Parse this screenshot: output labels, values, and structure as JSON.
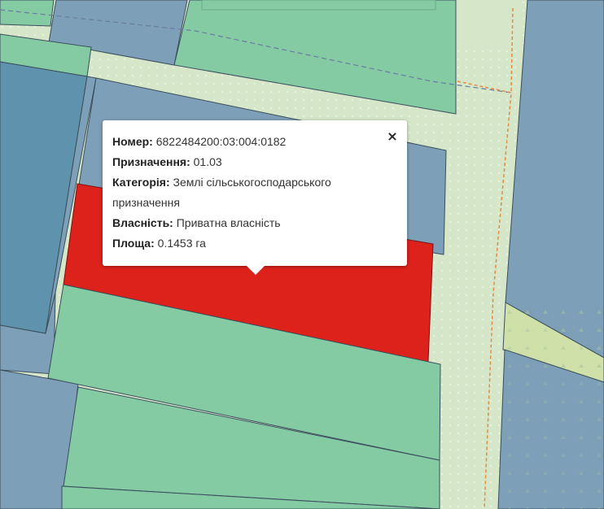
{
  "colors": {
    "background": "#d5e6c9",
    "parcel_blue": "#7d9fb7",
    "parcel_deep_blue": "#5f93ad",
    "parcel_green": "#84cba3",
    "selected_parcel": "#dd221c",
    "road_boundary_orange": "#e28b44"
  },
  "popup": {
    "close_symbol": "×",
    "fields": [
      {
        "label": "Номер:",
        "value": "6822484200:03:004:0182"
      },
      {
        "label": "Призначення:",
        "value": "01.03"
      },
      {
        "label": "Категорія:",
        "value": "Землі сільськогосподарського призначення"
      },
      {
        "label": "Власність:",
        "value": "Приватна власність"
      },
      {
        "label": "Площа:",
        "value": "0.1453 га"
      }
    ]
  }
}
